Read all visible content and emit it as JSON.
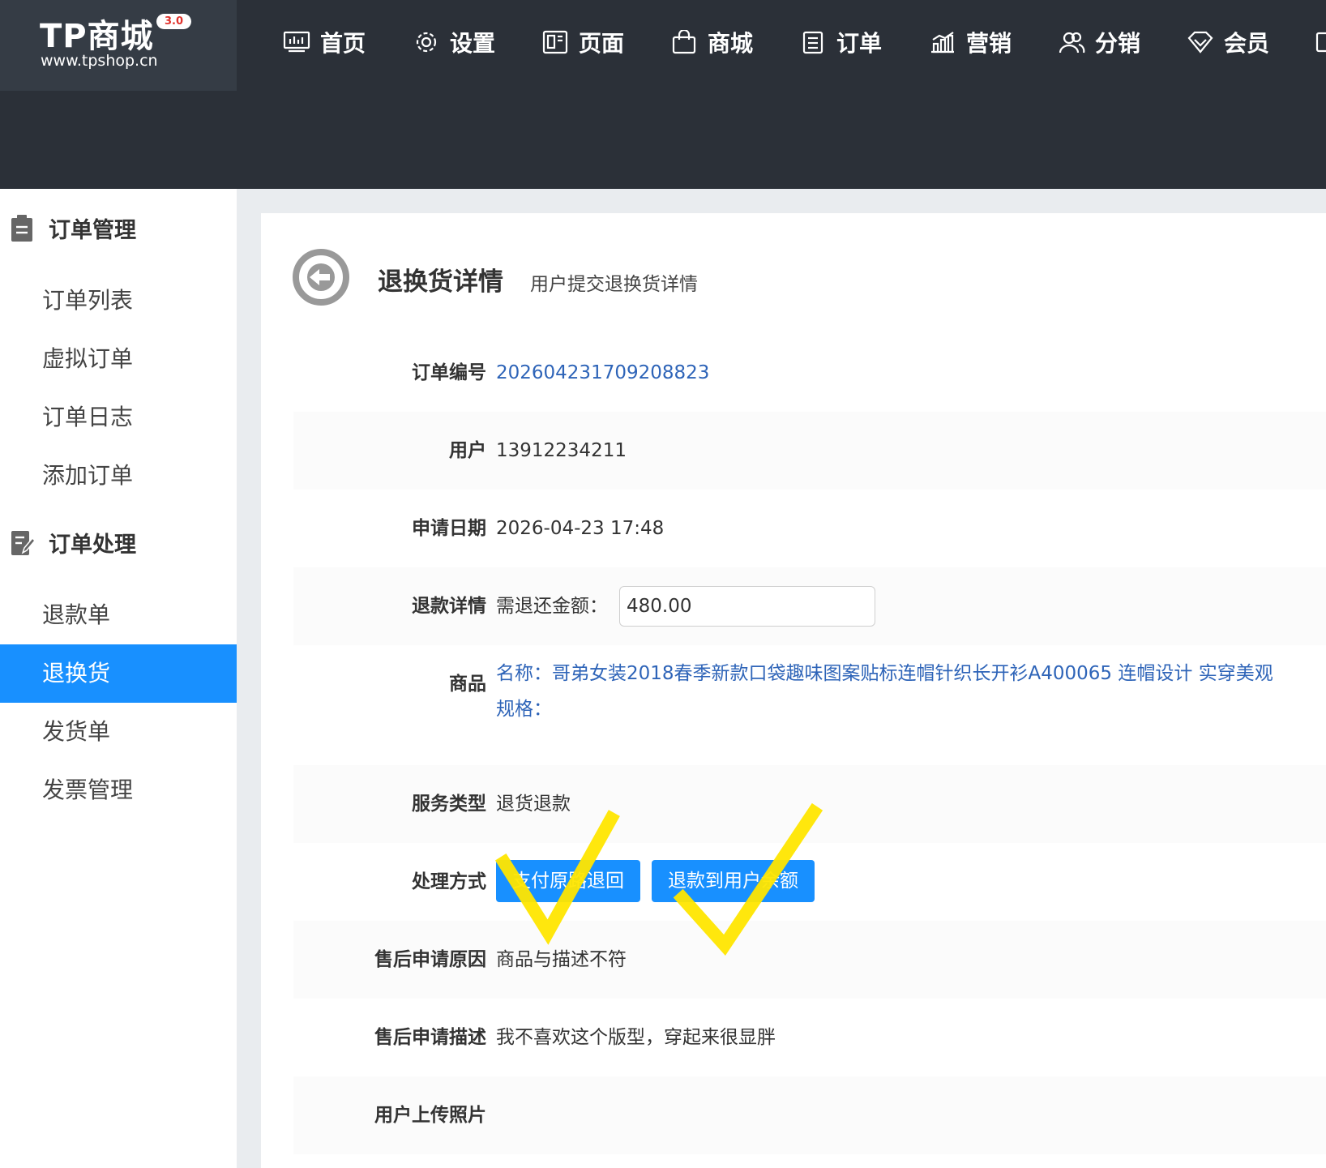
{
  "brand": {
    "name": "TP商城",
    "version": "3.0",
    "url": "www.tpshop.cn"
  },
  "topnav": [
    {
      "label": "首页",
      "icon": "monitor-icon"
    },
    {
      "label": "设置",
      "icon": "gear-icon"
    },
    {
      "label": "页面",
      "icon": "page-layout-icon"
    },
    {
      "label": "商城",
      "icon": "shopping-bag-icon"
    },
    {
      "label": "订单",
      "icon": "clipboard-icon"
    },
    {
      "label": "营销",
      "icon": "bar-chart-icon"
    },
    {
      "label": "分销",
      "icon": "users-icon"
    },
    {
      "label": "会员",
      "icon": "diamond-icon"
    }
  ],
  "sidebar": {
    "groups": [
      {
        "label": "订单管理",
        "icon": "clipboard-icon",
        "items": [
          "订单列表",
          "虚拟订单",
          "订单日志",
          "添加订单"
        ]
      },
      {
        "label": "订单处理",
        "icon": "edit-document-icon",
        "items": [
          "退款单",
          "退换货",
          "发货单",
          "发票管理"
        ]
      }
    ],
    "active_item": "退换货"
  },
  "page": {
    "title": "退换货详情",
    "subtitle": "用户提交退换货详情"
  },
  "details": {
    "order_no": {
      "label": "订单编号",
      "value": "202604231709208823"
    },
    "user": {
      "label": "用户",
      "value": "13912234211"
    },
    "apply_date": {
      "label": "申请日期",
      "value": "2026-04-23 17:48"
    },
    "refund": {
      "label": "退款详情",
      "prefix": "需退还金额：",
      "amount": "480.00"
    },
    "goods": {
      "label": "商品",
      "name": "名称：哥弟女装2018春季新款口袋趣味图案贴标连帽针织长开衫A400065 连帽设计 实穿美观",
      "spec": "规格："
    },
    "service_type": {
      "label": "服务类型",
      "value": "退货退款"
    },
    "process": {
      "label": "处理方式",
      "buttons": [
        "支付原路退回",
        "退款到用户余额"
      ]
    },
    "reason": {
      "label": "售后申请原因",
      "value": "商品与描述不符"
    },
    "description": {
      "label": "售后申请描述",
      "value": "我不喜欢这个版型，穿起来很显胖"
    },
    "photos": {
      "label": "用户上传照片"
    }
  },
  "colors": {
    "topbar": "#2b3038",
    "accent": "#1890ff",
    "link": "#2e64b8",
    "annotation": "#ffe600"
  }
}
